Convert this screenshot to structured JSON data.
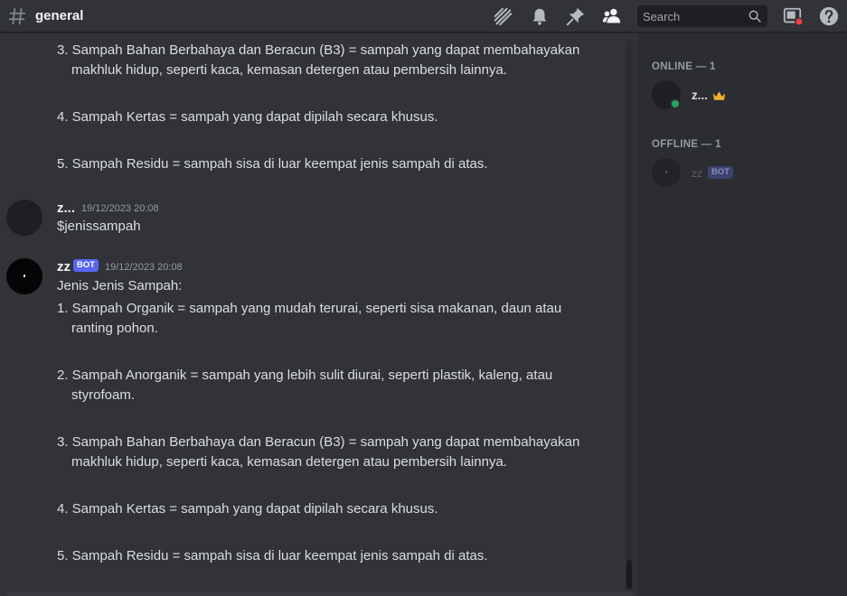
{
  "header": {
    "channel_name": "general",
    "search_placeholder": "Search"
  },
  "messages": [
    {
      "lines": [
        "3. Sampah Bahan Berbahaya dan Beracun (B3) = sampah yang dapat membahayakan",
        "makhluk hidup, seperti kaca, kemasan detergen atau pembersih lainnya.",
        "4. Sampah Kertas = sampah yang dapat dipilah secara khusus.",
        "5. Sampah Residu = sampah sisa di luar keempat jenis sampah di atas."
      ]
    },
    {
      "author": "z...",
      "timestamp": "19/12/2023 20:08",
      "content": "$jenissampah"
    },
    {
      "author": "zz",
      "badge": "BOT",
      "timestamp": "19/12/2023 20:08",
      "title": "Jenis Jenis Sampah:",
      "lines": [
        "1. Sampah Organik = sampah yang mudah terurai, seperti sisa makanan, daun atau",
        "ranting pohon.",
        "2. Sampah Anorganik = sampah yang lebih sulit diurai, seperti plastik, kaleng, atau",
        "styrofoam.",
        "3. Sampah Bahan Berbahaya dan Beracun (B3) = sampah yang dapat membahayakan",
        "makhluk hidup, seperti kaca, kemasan detergen atau pembersih lainnya.",
        "4. Sampah Kertas = sampah yang dapat dipilah secara khusus.",
        "5. Sampah Residu = sampah sisa di luar keempat jenis sampah di atas."
      ]
    }
  ],
  "members": {
    "online_title": "ONLINE — 1",
    "online": [
      {
        "name": "z...",
        "status": "online",
        "crown": true
      }
    ],
    "offline_title": "OFFLINE — 1",
    "offline": [
      {
        "name": "zz",
        "badge": "BOT"
      }
    ]
  },
  "colors": {
    "background": "#313338",
    "sidebar": "#2b2d31",
    "bot_badge": "#5865f2",
    "online_status": "#23a55a",
    "crown": "#f0b232",
    "notification": "#f23f43"
  },
  "icons": [
    "hash-icon",
    "threads-icon",
    "bell-icon",
    "pin-icon",
    "members-icon",
    "search-icon",
    "inbox-icon",
    "help-icon",
    "crown-icon"
  ]
}
